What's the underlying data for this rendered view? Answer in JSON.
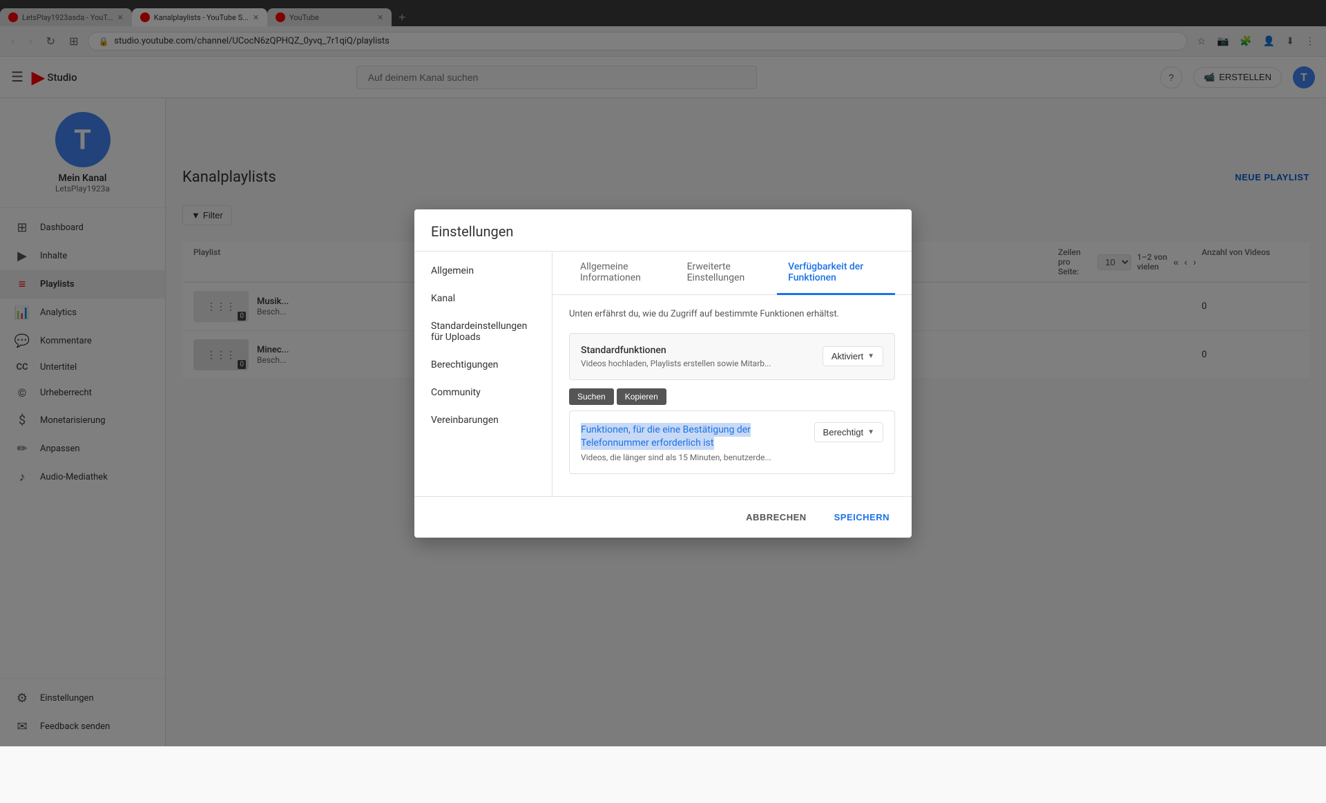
{
  "browser": {
    "tabs": [
      {
        "id": "tab1",
        "favicon_color": "#ff0000",
        "label": "LetsPlay1923asda - YouT...",
        "active": false
      },
      {
        "id": "tab2",
        "favicon_color": "#ff0000",
        "label": "Kanalplaylists - YouTube S...",
        "active": true
      },
      {
        "id": "tab3",
        "favicon_color": "#ff0000",
        "label": "YouTube",
        "active": false
      }
    ],
    "address": "studio.youtube.com/channel/UCocN6zQPHQZ_0yvq_7r1qiQ/playlists",
    "new_tab_label": "+"
  },
  "header": {
    "menu_icon": "☰",
    "logo_icon": "▶",
    "logo_text": "Studio",
    "search_placeholder": "Auf deinem Kanal suchen",
    "help_icon": "?",
    "create_label": "ERSTELLEN",
    "avatar_letter": "T"
  },
  "sidebar": {
    "channel_avatar_letter": "T",
    "channel_name": "Mein Kanal",
    "channel_handle": "LetsPlay1923a",
    "nav_items": [
      {
        "id": "dashboard",
        "icon": "⊞",
        "label": "Dashboard"
      },
      {
        "id": "content",
        "icon": "▶",
        "label": "Inhalte"
      },
      {
        "id": "playlists",
        "icon": "≡",
        "label": "Playlists",
        "active": true
      },
      {
        "id": "analytics",
        "icon": "📊",
        "label": "Analytics"
      },
      {
        "id": "comments",
        "icon": "💬",
        "label": "Kommentare"
      },
      {
        "id": "subtitles",
        "icon": "CC",
        "label": "Untertitel"
      },
      {
        "id": "copyright",
        "icon": "©",
        "label": "Urheberrecht"
      },
      {
        "id": "monetize",
        "icon": "$",
        "label": "Monetarisierung"
      },
      {
        "id": "customize",
        "icon": "✏",
        "label": "Anpassen"
      },
      {
        "id": "audio",
        "icon": "♪",
        "label": "Audio-Mediathek"
      }
    ],
    "bottom_items": [
      {
        "id": "settings",
        "icon": "⚙",
        "label": "Einstellungen"
      },
      {
        "id": "feedback",
        "icon": "✉",
        "label": "Feedback senden"
      }
    ]
  },
  "page": {
    "title": "Kanalplaylists",
    "new_playlist_label": "NEUE PLAYLIST",
    "filter_label": "Filter",
    "table_headers": [
      "Playlist",
      "",
      "",
      "Anzahl von Videos"
    ],
    "playlists": [
      {
        "name": "Musik...",
        "desc": "Besch...",
        "video_count": "0"
      },
      {
        "name": "Minec...",
        "desc": "Besch...",
        "video_count": "0"
      }
    ],
    "rows_per_page_label": "Zeilen pro Seite:",
    "rows_per_page_value": "10",
    "pagination_info": "1–2 von vielen",
    "pagination_first": "«",
    "pagination_prev": "‹",
    "pagination_next": "›"
  },
  "dialog": {
    "title": "Einstellungen",
    "nav_items": [
      {
        "id": "general",
        "label": "Allgemein",
        "active": false
      },
      {
        "id": "channel",
        "label": "Kanal",
        "active": false
      },
      {
        "id": "upload_defaults",
        "label": "Standardeinstellungen für Uploads",
        "active": false
      },
      {
        "id": "permissions",
        "label": "Berechtigungen",
        "active": false
      },
      {
        "id": "community",
        "label": "Community",
        "active": false
      },
      {
        "id": "agreements",
        "label": "Vereinbarungen",
        "active": false
      }
    ],
    "tabs": [
      {
        "id": "general_info",
        "label": "Allgemeine Informationen"
      },
      {
        "id": "advanced",
        "label": "Erweiterte Einstellungen"
      },
      {
        "id": "availability",
        "label": "Verfügbarkeit der Funktionen",
        "active": true
      }
    ],
    "active_tab_content": {
      "info_text": "Unten erfährst du, wie du Zugriff auf bestimmte Funktionen erhältst.",
      "standard_features": {
        "title": "Standardfunktionen",
        "desc": "Videos hochladen, Playlists erstellen sowie Mitarb...",
        "status": "Aktiviert",
        "has_dropdown": true
      },
      "context_menu": {
        "search_label": "Suchen",
        "copy_label": "Kopieren"
      },
      "phone_features": {
        "title_highlighted": "Funktionen, für die eine Bestätigung der Telefonnummer erforderlich ist",
        "desc": "Videos, die länger sind als 15 Minuten, benutzerde...",
        "status": "Berechtigt",
        "has_dropdown": true
      }
    },
    "footer": {
      "cancel_label": "ABBRECHEN",
      "save_label": "SPEICHERN"
    }
  }
}
